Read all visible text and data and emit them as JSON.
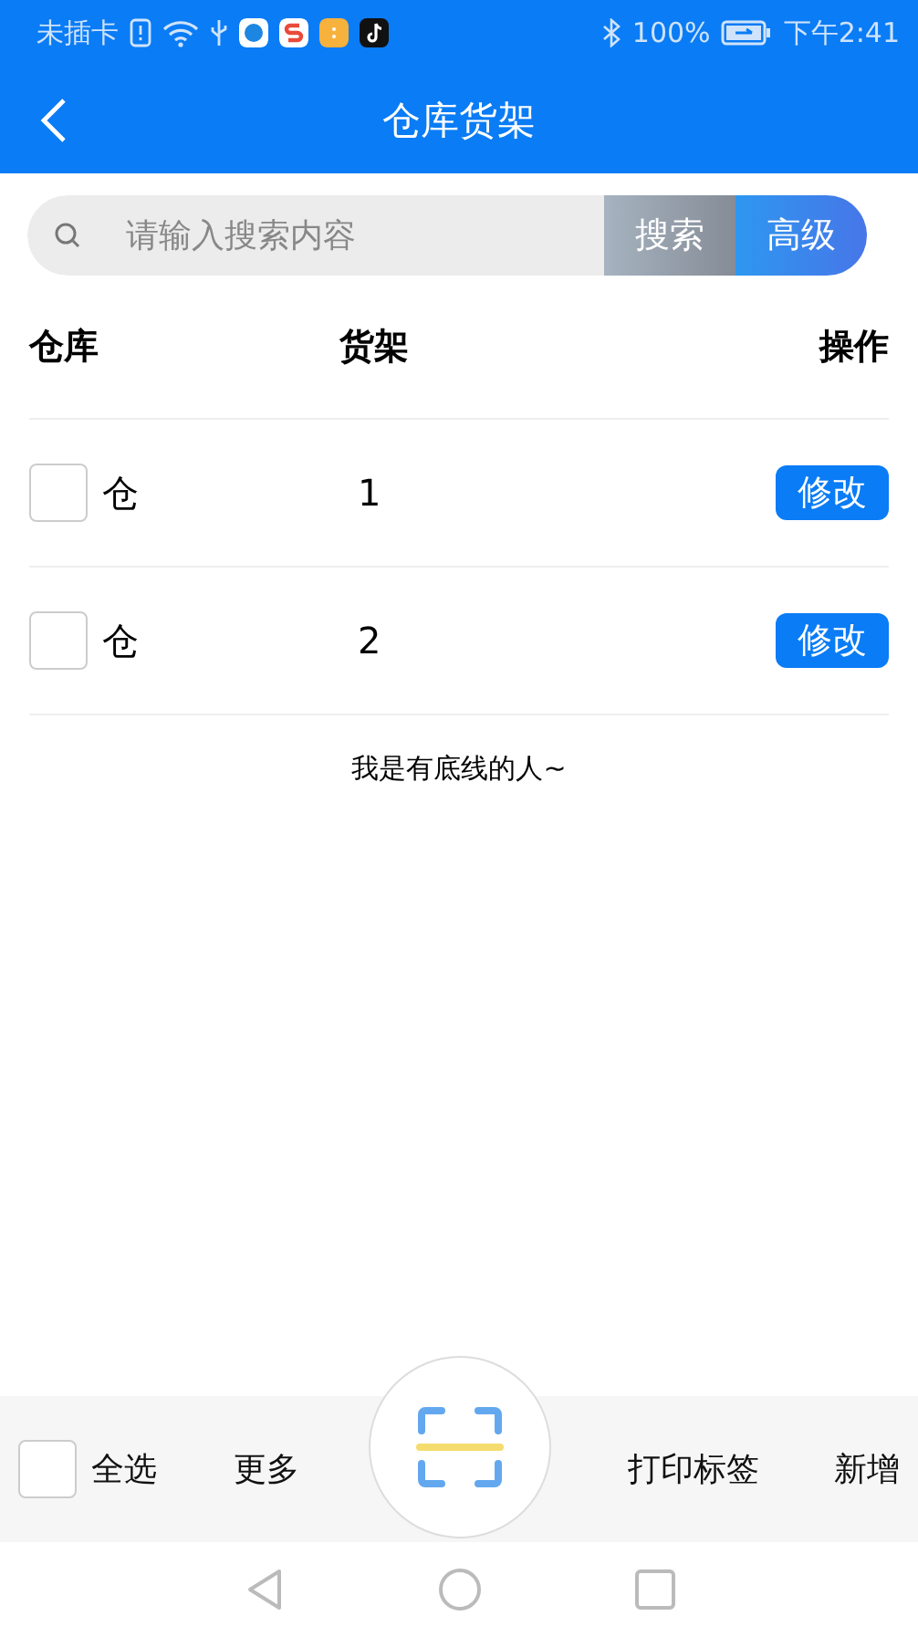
{
  "status_bar": {
    "carrier": "未插卡",
    "battery": "100%",
    "time": "下午2:41"
  },
  "header": {
    "title": "仓库货架"
  },
  "search": {
    "placeholder": "请输入搜索内容",
    "search_button": "搜索",
    "advanced_button": "高级"
  },
  "table": {
    "columns": [
      "仓库",
      "货架",
      "操作"
    ],
    "rows": [
      {
        "checked": false,
        "warehouse": "仓",
        "shelf": "1",
        "action": "修改"
      },
      {
        "checked": false,
        "warehouse": "仓",
        "shelf": "2",
        "action": "修改"
      }
    ]
  },
  "footer_note": "我是有底线的人~",
  "bottom_bar": {
    "select_all": {
      "label": "全选",
      "checked": false
    },
    "more": "更多",
    "print": "打印标签",
    "add": "新增"
  }
}
